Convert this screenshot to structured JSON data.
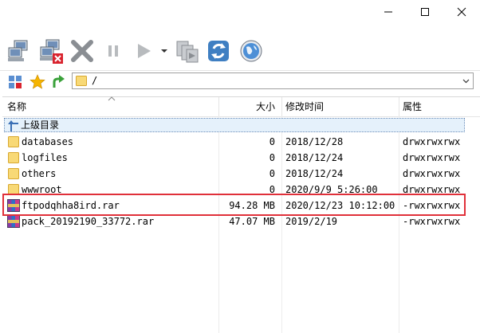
{
  "window": {
    "minimize_glyph": "─",
    "maximize_glyph": "☐",
    "close_glyph": "✕"
  },
  "toolbar": {
    "icons": [
      "connect-icon",
      "disconnect-icon",
      "abort-icon",
      "pause-icon",
      "play-icon",
      "dropdown-arrow-icon",
      "queue-icon",
      "refresh-icon",
      "globe-icon"
    ]
  },
  "address": {
    "path": "/"
  },
  "columns": {
    "name": "名称",
    "size": "大小",
    "modified": "修改时间",
    "attributes": "属性"
  },
  "parent": {
    "label": "上级目录"
  },
  "files": [
    {
      "name": "databases",
      "size": "0",
      "modified": "2018/12/28",
      "attr": "drwxrwxrwx",
      "type": "folder"
    },
    {
      "name": "logfiles",
      "size": "0",
      "modified": "2018/12/24",
      "attr": "drwxrwxrwx",
      "type": "folder"
    },
    {
      "name": "others",
      "size": "0",
      "modified": "2018/12/24",
      "attr": "drwxrwxrwx",
      "type": "folder"
    },
    {
      "name": "wwwroot",
      "size": "0",
      "modified": "2020/9/9 5:26:00",
      "attr": "drwxrwxrwx",
      "type": "folder"
    },
    {
      "name": "ftpodqhha8ird.rar",
      "size": "94.28 MB",
      "modified": "2020/12/23 10:12:00",
      "attr": "-rwxrwxrwx",
      "type": "rar"
    },
    {
      "name": "pack_20192190_33772.rar",
      "size": "47.07 MB",
      "modified": "2019/2/19",
      "attr": "-rwxrwxrwx",
      "type": "rar"
    }
  ],
  "colors": {
    "highlight": "#e0303a",
    "selection": "#e5f1fb",
    "folder": "#f4c94e"
  }
}
